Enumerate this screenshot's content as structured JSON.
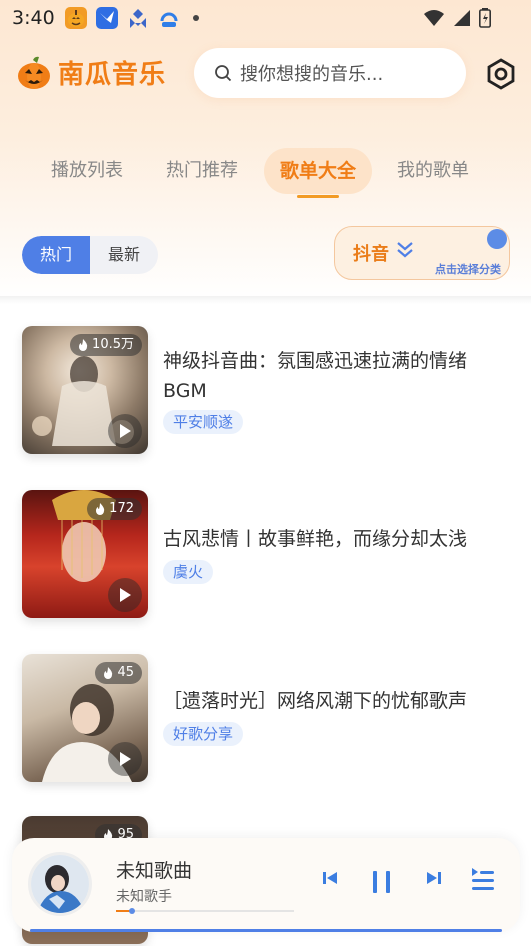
{
  "status_bar": {
    "time": "3:40",
    "icons": [
      "pumpkin-app-icon",
      "bird-app-icon",
      "puzzle-app-icon",
      "cloud-app-icon"
    ]
  },
  "header": {
    "logo_text": "南瓜音乐",
    "search_placeholder": "搜你想搜的音乐..."
  },
  "tabs": [
    {
      "label": "播放列表"
    },
    {
      "label": "热门推荐"
    },
    {
      "label": "歌单大全",
      "active": true
    },
    {
      "label": "我的歌单"
    }
  ],
  "filter": {
    "segments": [
      {
        "label": "热门",
        "active": true
      },
      {
        "label": "最新"
      }
    ],
    "category_label": "抖音",
    "category_hint": "点击选择分类"
  },
  "playlists": [
    {
      "title": "神级抖音曲：氛围感迅速拉满的情绪BGM",
      "tag": "平安顺遂",
      "plays": "10.5万"
    },
    {
      "title": "古风悲情丨故事鲜艳，而缘分却太浅",
      "tag": "虞火",
      "plays": "172"
    },
    {
      "title": "［遗落时光］网络风潮下的忧郁歌声",
      "tag": "好歌分享",
      "plays": "45"
    },
    {
      "title": "",
      "tag": "",
      "plays": "95"
    }
  ],
  "player": {
    "title": "未知歌曲",
    "artist": "未知歌手",
    "progress": 0.09
  },
  "colors": {
    "accent_orange": "#f07d16",
    "accent_blue": "#4f7fe6"
  }
}
